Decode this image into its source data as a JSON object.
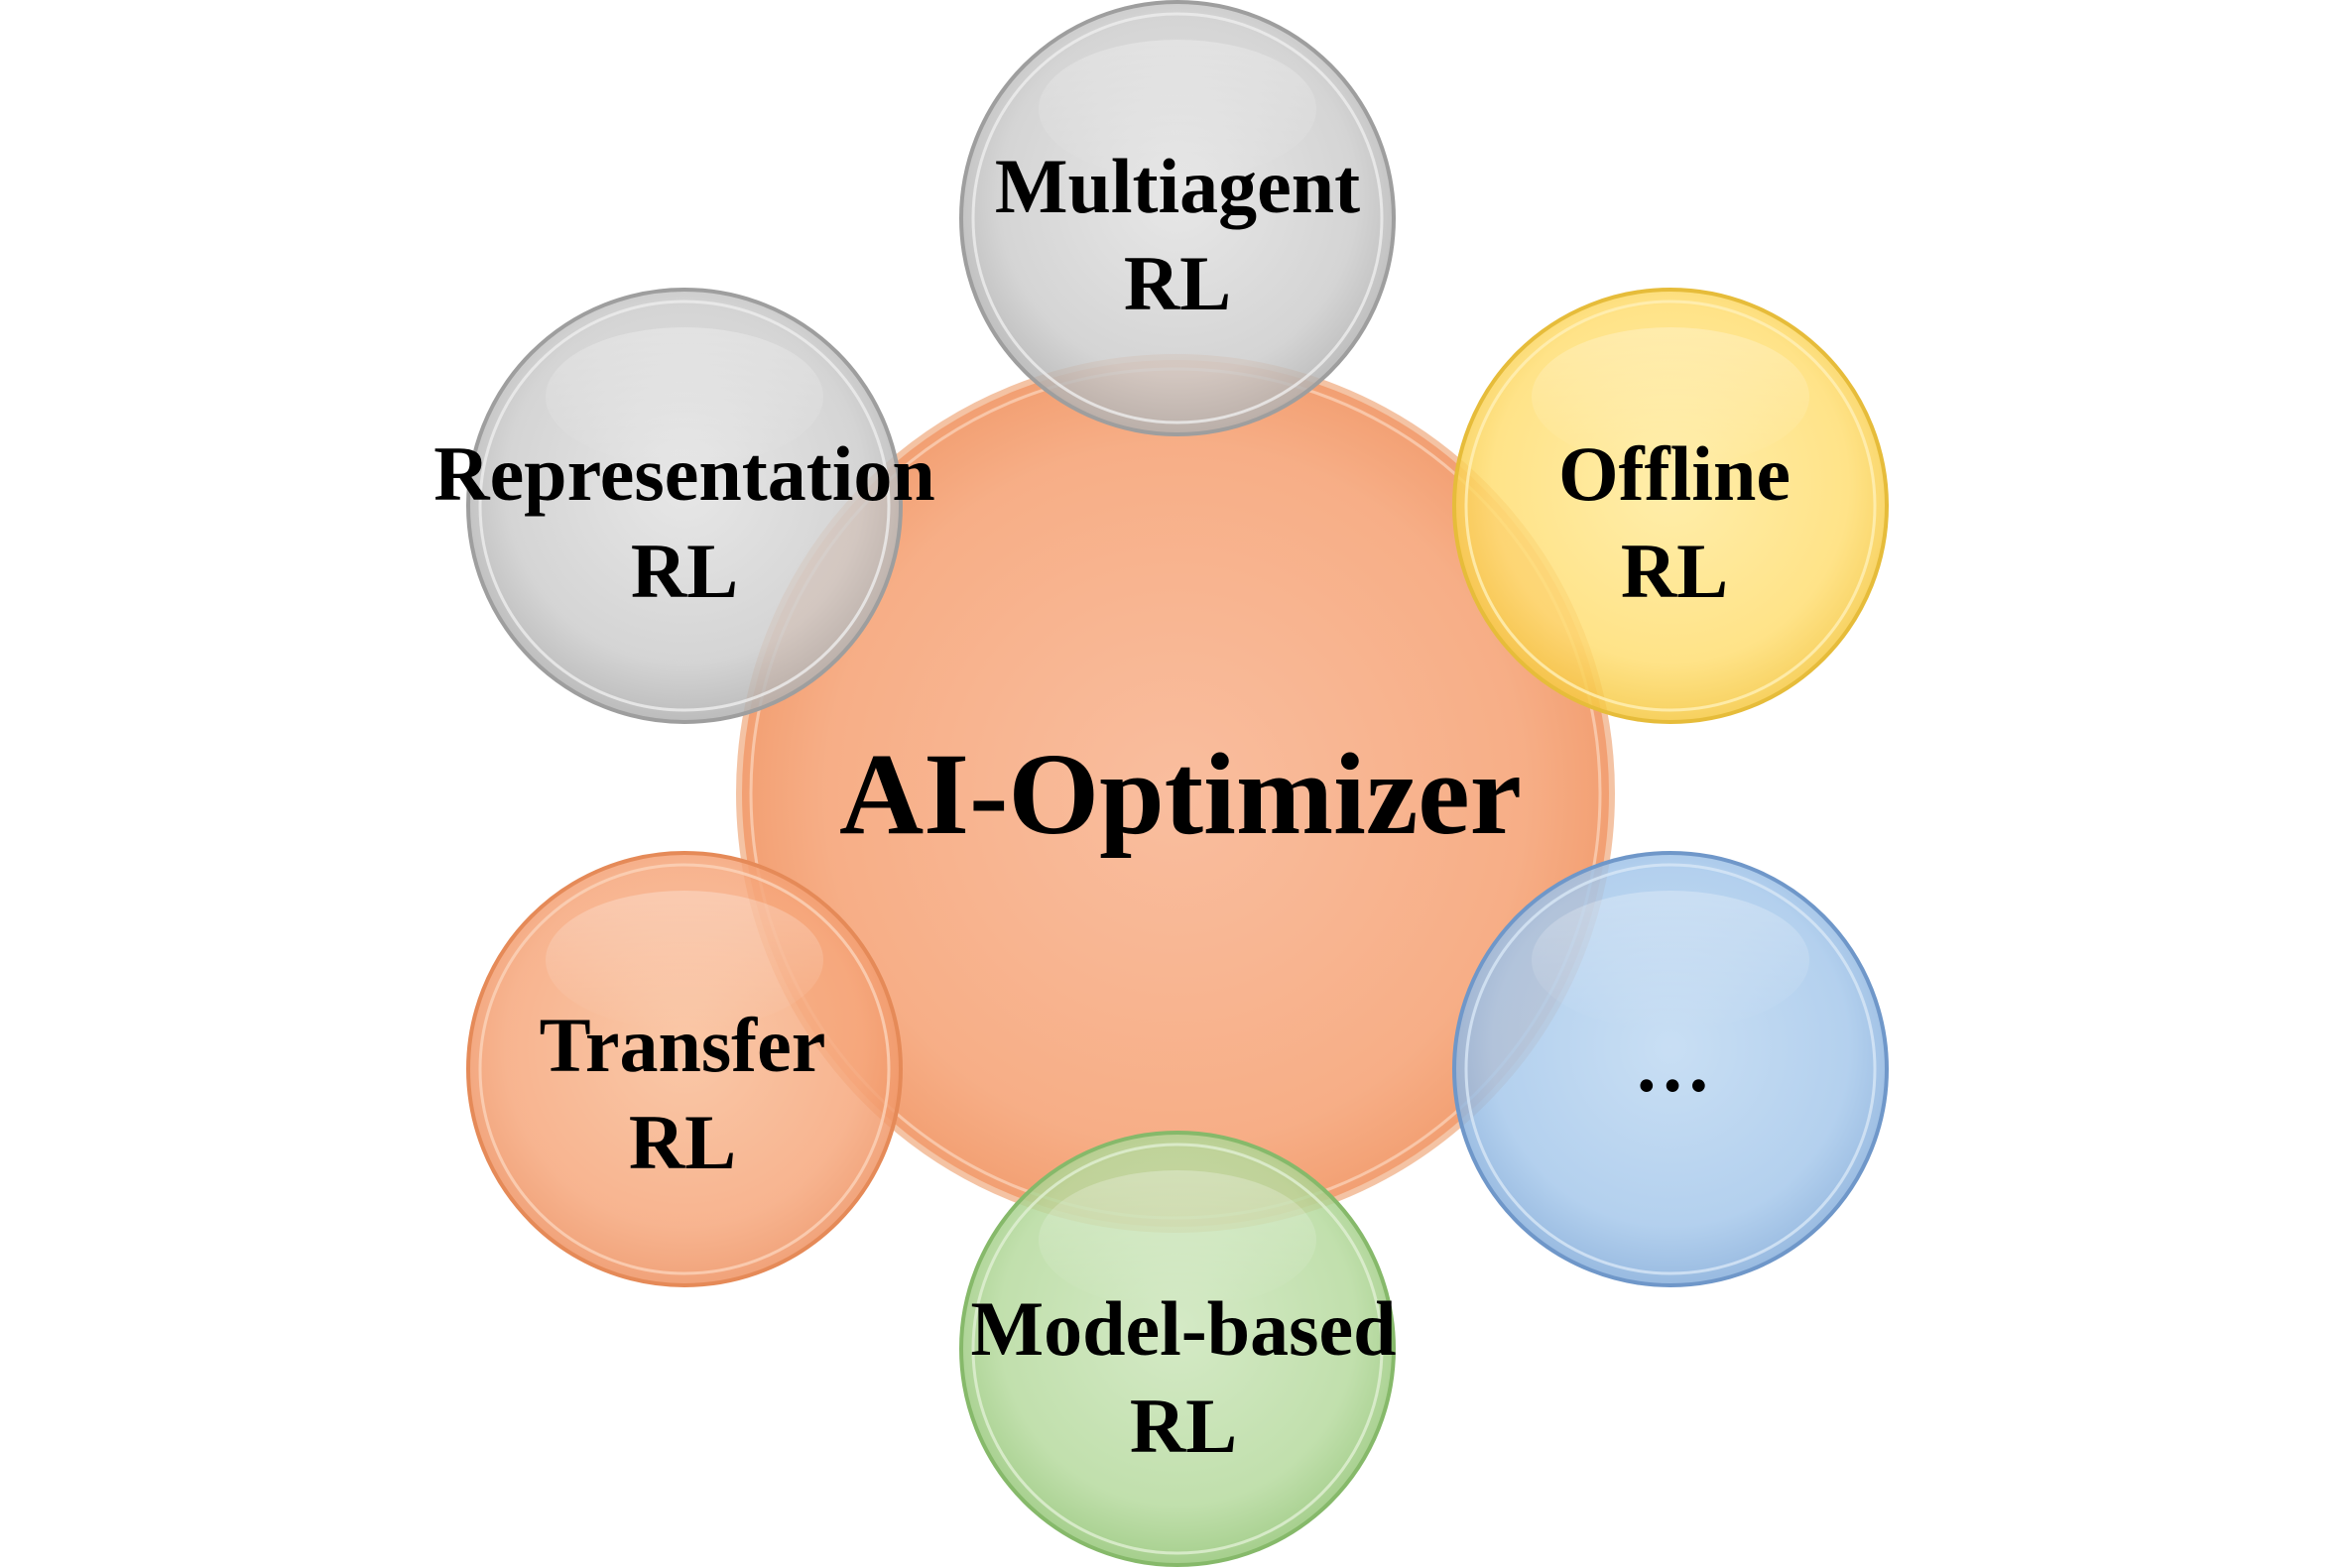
{
  "center": {
    "label": "AI-Optimizer",
    "color": "#F7A77A"
  },
  "satellites": [
    {
      "id": "multiagent",
      "line1": "Multiagent",
      "line2": "RL",
      "color": "#BFBFBF"
    },
    {
      "id": "offline",
      "line1": "Offline",
      "line2": "RL",
      "color": "#FFD966"
    },
    {
      "id": "ellipsis",
      "line1": "…",
      "line2": "",
      "color": "#9DC3E6"
    },
    {
      "id": "model-based",
      "line1": "Model-based",
      "line2": "RL",
      "color": "#A9D18E"
    },
    {
      "id": "transfer",
      "line1": "Transfer",
      "line2": "RL",
      "color": "#F4A674"
    },
    {
      "id": "representation",
      "line1": "Representation",
      "line2": "RL",
      "color": "#BFBFBF"
    }
  ]
}
